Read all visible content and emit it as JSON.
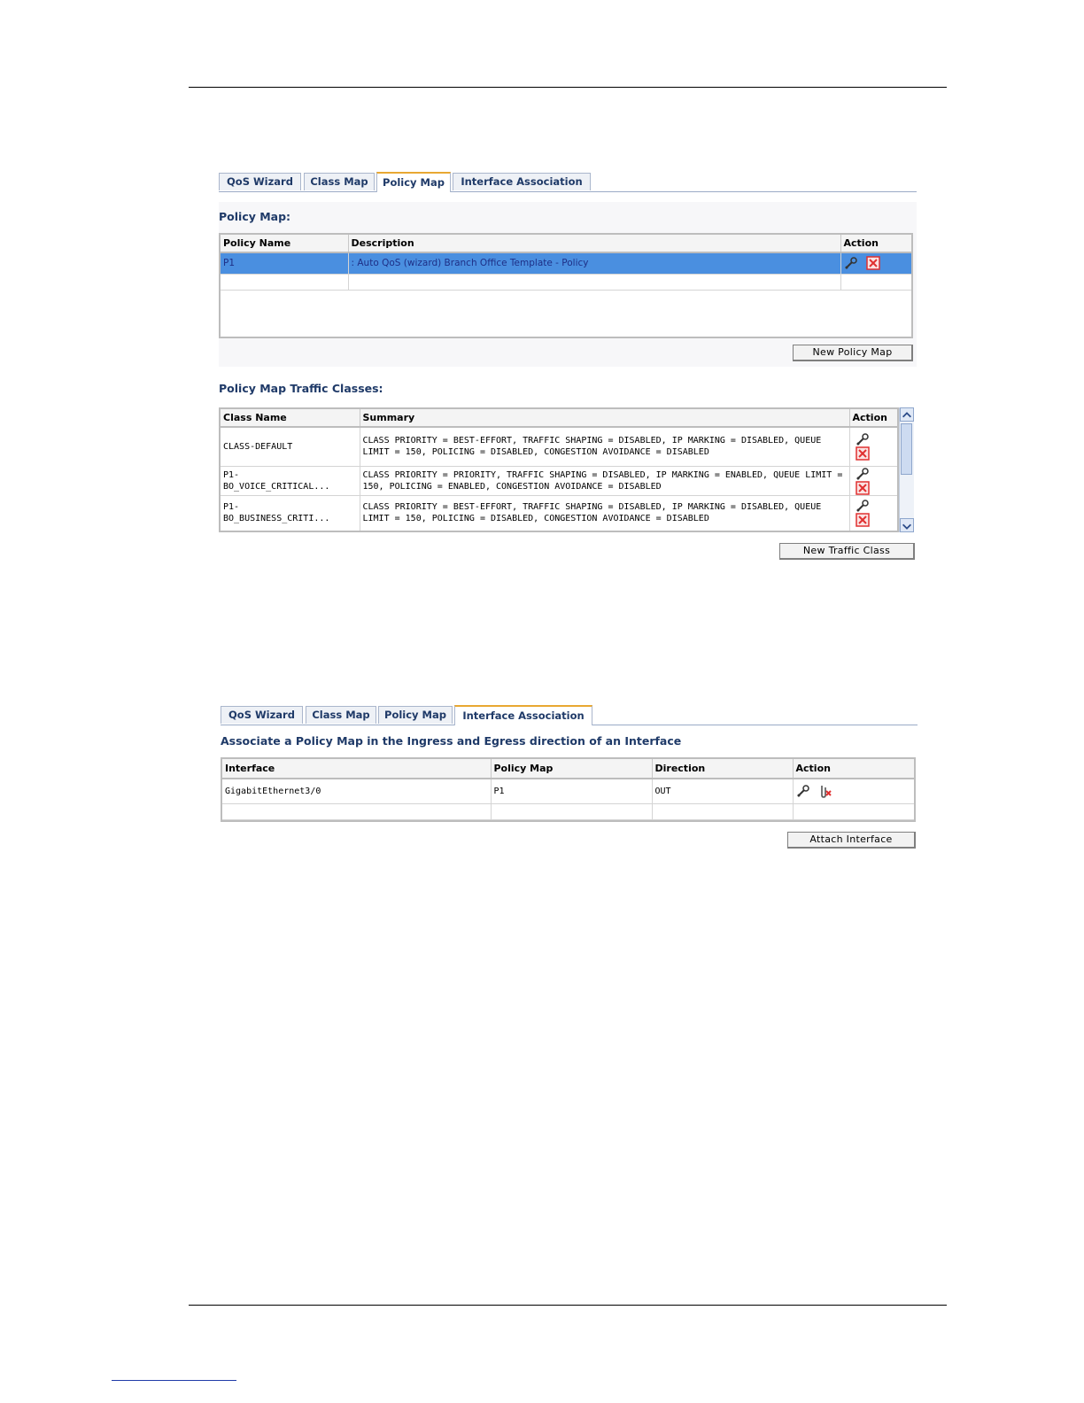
{
  "tabs_top": {
    "items": [
      {
        "label": "QoS Wizard"
      },
      {
        "label": "Class Map"
      },
      {
        "label": "Policy Map"
      },
      {
        "label": "Interface Association"
      }
    ],
    "active": "Policy Map"
  },
  "policy_map": {
    "title": "Policy Map:",
    "columns": [
      "Policy Name",
      "Description",
      "Action"
    ],
    "rows": [
      {
        "name": "P1",
        "description": ": Auto QoS (wizard) Branch Office Template - Policy"
      }
    ],
    "new_button": "New Policy Map"
  },
  "traffic_classes": {
    "title": "Policy Map Traffic Classes:",
    "columns": [
      "Class Name",
      "Summary",
      "Action"
    ],
    "rows": [
      {
        "name": "CLASS-DEFAULT",
        "summary": "CLASS PRIORITY = BEST-EFFORT, TRAFFIC SHAPING = DISABLED, IP MARKING = DISABLED, QUEUE LIMIT = 150, POLICING = DISABLED, CONGESTION AVOIDANCE = DISABLED"
      },
      {
        "name": "P1-\nBO_VOICE_CRITICAL...",
        "summary": "CLASS PRIORITY = PRIORITY, TRAFFIC SHAPING = DISABLED, IP MARKING = ENABLED, QUEUE LIMIT = 150, POLICING = ENABLED, CONGESTION AVOIDANCE = DISABLED"
      },
      {
        "name": "P1-\nBO_BUSINESS_CRITI...",
        "summary": "CLASS PRIORITY = BEST-EFFORT, TRAFFIC SHAPING = DISABLED, IP MARKING = DISABLED, QUEUE LIMIT = 150, POLICING = DISABLED, CONGESTION AVOIDANCE = DISABLED"
      }
    ],
    "new_button": "New Traffic Class"
  },
  "tabs_bottom": {
    "items": [
      {
        "label": "QoS Wizard"
      },
      {
        "label": "Class Map"
      },
      {
        "label": "Policy Map"
      },
      {
        "label": "Interface Association"
      }
    ],
    "active": "Interface Association"
  },
  "interface_assoc": {
    "title": "Associate a Policy Map in the Ingress and Egress direction of an Interface",
    "columns": [
      "Interface",
      "Policy Map",
      "Direction",
      "Action"
    ],
    "rows": [
      {
        "interface": "GigabitEthernet3/0",
        "policy_map": "P1",
        "direction": "OUT"
      }
    ],
    "attach_button": "Attach Interface"
  },
  "colors": {
    "selected_row": "#4a8fe0",
    "heading": "#1f3a68",
    "active_tab_accent": "#e8a832",
    "delete_red": "#e03030"
  },
  "icons": {
    "edit": "edit-wrench-icon",
    "delete": "delete-x-icon",
    "detach": "detach-interface-icon"
  }
}
